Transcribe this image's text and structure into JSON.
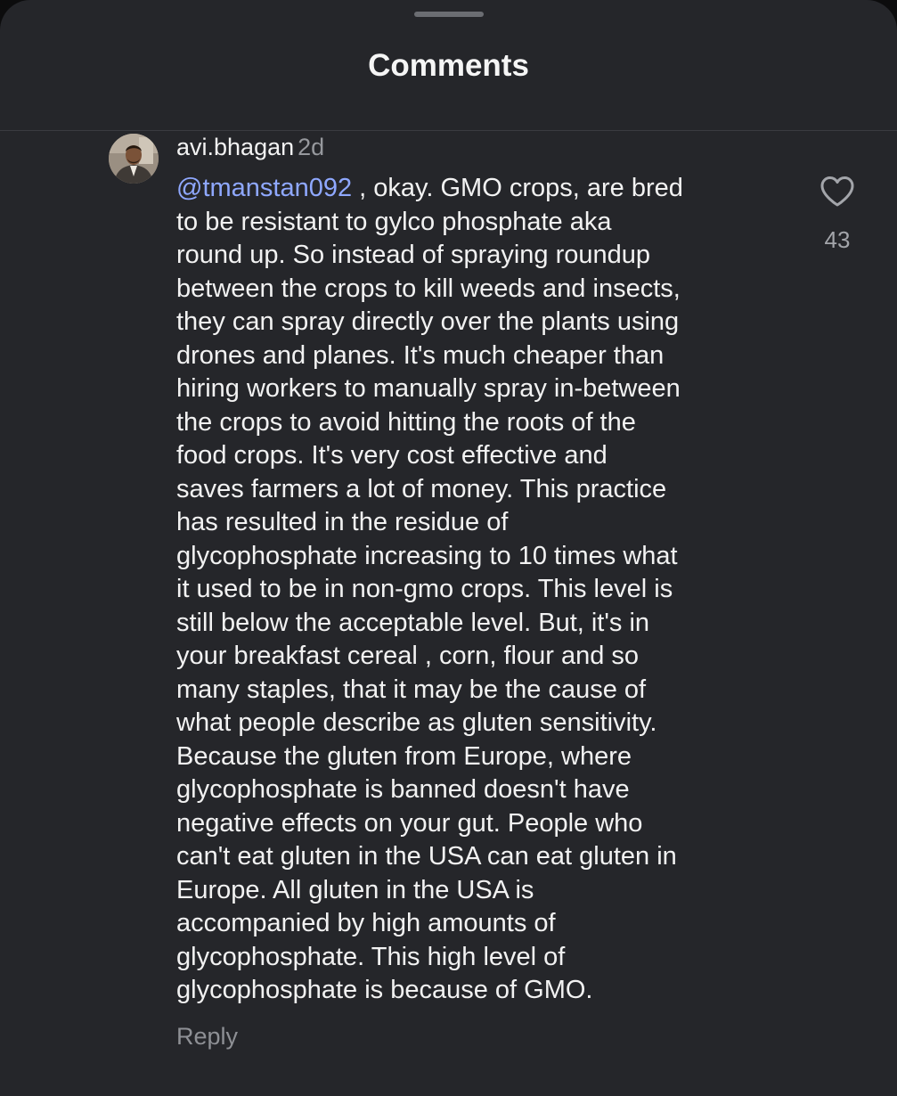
{
  "header": {
    "title": "Comments"
  },
  "comment": {
    "username": "avi.bhagan",
    "time_ago": "2d",
    "mention": "@tmanstan092",
    "body_lines": [
      " , okay. GMO crops, are bred",
      "to be resistant to gylco phosphate aka",
      "round up. So instead of spraying roundup",
      "between the crops to kill weeds and insects,",
      "they can spray directly over the plants using",
      "drones and planes. It's much cheaper than",
      "hiring workers to manually spray in-between",
      "the crops to avoid hitting the roots of the",
      "food crops. It's very cost effective and",
      "saves farmers a lot of money. This practice",
      "has resulted in the residue of",
      "glycophosphate increasing to 10 times what",
      "it used to be in non-gmo crops. This level is",
      "still below the acceptable level. But, it's in",
      "your breakfast cereal , corn, flour and so",
      "many staples, that it may be the cause of",
      "what people describe as gluten sensitivity.",
      "Because the gluten from Europe, where",
      "glycophosphate is banned doesn't have",
      "negative effects on your gut. People who",
      "can't eat gluten in the USA can eat gluten in",
      "Europe. All gluten in the USA is",
      "accompanied by high amounts of",
      "glycophosphate. This high level of",
      "glycophosphate is because of GMO."
    ],
    "like_count": "43",
    "reply_label": "Reply",
    "like_icon": "heart-outline-icon",
    "avatar_icon": "user-avatar"
  },
  "colors": {
    "background": "#25262a",
    "text": "#f2f2f2",
    "muted": "#8e9095",
    "mention": "#8fa8ff",
    "divider": "#3a3b40"
  }
}
